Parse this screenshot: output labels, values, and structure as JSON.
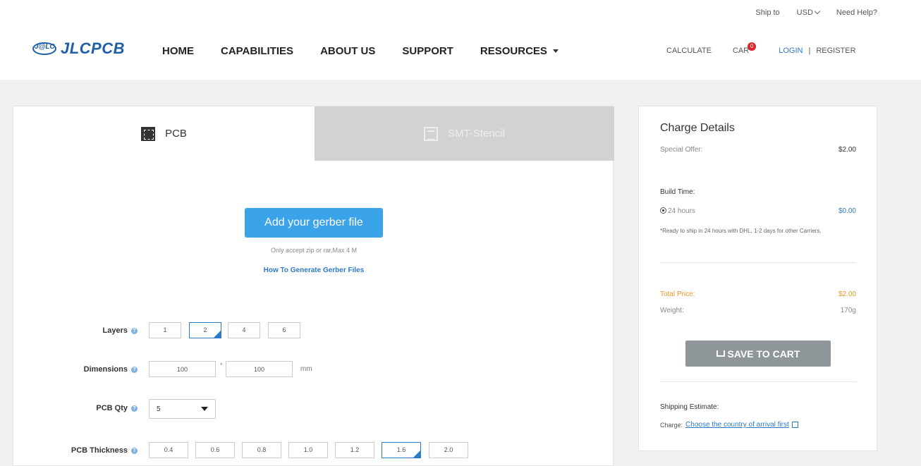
{
  "topbar": {
    "ship_to": "Ship to",
    "currency": "USD",
    "help": "Need Help?"
  },
  "logo": {
    "mark": "J@LC",
    "name": "JLCPCB"
  },
  "nav": {
    "home": "HOME",
    "capabilities": "CAPABILITIES",
    "about": "ABOUT US",
    "support": "SUPPORT",
    "resources": "RESOURCES"
  },
  "right_nav": {
    "calculate": "CALCULATE",
    "cart": "CAR",
    "cart_count": "0",
    "login": "LOGIN",
    "separator": "|",
    "register": "REGISTER"
  },
  "tabs": {
    "pcb": "PCB",
    "smt": "SMT-Stencil"
  },
  "upload": {
    "button": "Add your gerber file",
    "note": "Only accept zip or rar,Max 4 M",
    "howto": "How To Generate Gerber Files"
  },
  "form": {
    "layers": {
      "label": "Layers",
      "options": [
        "1",
        "2",
        "4",
        "6"
      ],
      "selected": "2"
    },
    "dimensions": {
      "label": "Dimensions",
      "width": "100",
      "height": "100",
      "x": "*",
      "unit": "mm"
    },
    "qty": {
      "label": "PCB Qty",
      "value": "5"
    },
    "thickness": {
      "label": "PCB Thickness",
      "options": [
        "0.4",
        "0.6",
        "0.8",
        "1.0",
        "1.2",
        "1.6",
        "2.0"
      ],
      "selected": "1.6"
    }
  },
  "charge": {
    "title": "Charge Details",
    "special_offer": {
      "label": "Special Offer:",
      "value": "$2.00"
    },
    "build_time": {
      "label": "Build Time:",
      "option": "24 hours",
      "price": "$0.00",
      "note": "*Ready to ship in 24 hours with DHL, 1-2 days for other Carriers."
    },
    "total": {
      "label": "Total Price:",
      "value": "$2.00"
    },
    "weight": {
      "label": "Weight:",
      "value": "170g"
    },
    "save_button": "SAVE TO CART",
    "shipping": {
      "label": "Shipping Estimate:",
      "charge_label": "Charge:",
      "link": "Choose the country of arrival first"
    }
  },
  "colors": {
    "accent": "#3ba3ea",
    "brand": "#1f5ea8",
    "link": "#2c7bc9",
    "total": "#e8982b",
    "cart_badge": "#d9262b"
  }
}
